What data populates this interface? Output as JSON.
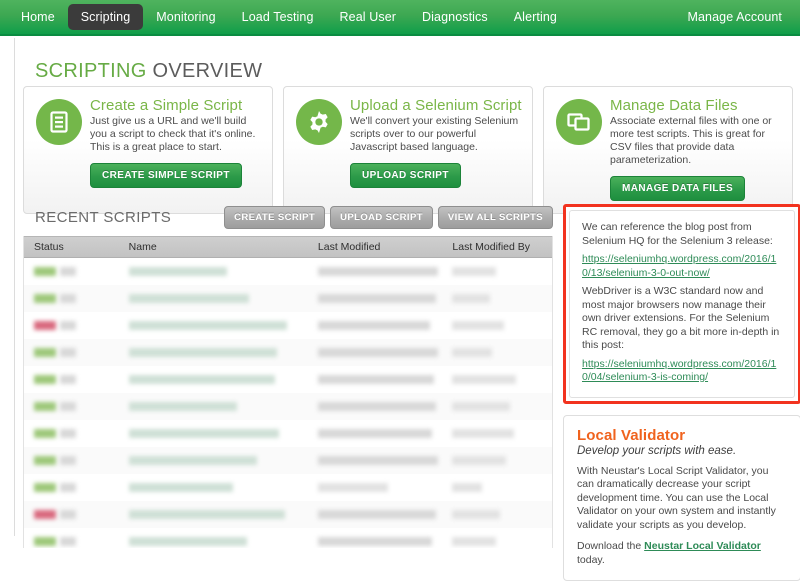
{
  "nav": {
    "items": [
      {
        "label": "Home",
        "active": false
      },
      {
        "label": "Scripting",
        "active": true
      },
      {
        "label": "Monitoring",
        "active": false
      },
      {
        "label": "Load Testing",
        "active": false
      },
      {
        "label": "Real User",
        "active": false
      },
      {
        "label": "Diagnostics",
        "active": false
      },
      {
        "label": "Alerting",
        "active": false
      }
    ],
    "account_label": "Manage Account"
  },
  "page": {
    "title_highlight": "SCRIPTING",
    "title_rest": " OVERVIEW"
  },
  "cards": [
    {
      "icon": "document-lines-icon",
      "title": "Create a Simple Script",
      "desc": "Just give us a URL and we'll build you a script to check that it's online. This is a great place to start.",
      "button": "CREATE SIMPLE SCRIPT"
    },
    {
      "icon": "gear-icon",
      "title": "Upload a Selenium Script",
      "desc": "We'll convert your existing Selenium scripts over to our powerful Javascript based language.",
      "button": "UPLOAD SCRIPT"
    },
    {
      "icon": "files-stack-icon",
      "title": "Manage Data Files",
      "desc": "Associate external files with one or more test scripts. This is great for CSV files that provide data parameterization.",
      "button": "MANAGE DATA FILES"
    }
  ],
  "recent": {
    "heading": "RECENT SCRIPTS",
    "buttons": [
      "CREATE SCRIPT",
      "UPLOAD SCRIPT",
      "VIEW ALL SCRIPTS"
    ],
    "columns": [
      "Status",
      "Name",
      "Last Modified",
      "Last Modified By"
    ],
    "rows_redacted": 11
  },
  "note": {
    "paragraph1": "We can reference the blog post from Selenium HQ for the Selenium 3 release:",
    "link1": "https://seleniumhq.wordpress.com/2016/10/13/selenium-3-0-out-now/",
    "paragraph2": "WebDriver is a W3C standard now and most major browsers now manage their own driver extensions. For the Selenium RC removal, they go a bit more in-depth in this post:",
    "link2": "https://seleniumhq.wordpress.com/2016/10/04/selenium-3-is-coming/",
    "highlight_color": "#f2331f"
  },
  "local_validator": {
    "title": "Local Validator",
    "subtitle": "Develop your scripts with ease.",
    "body": "With Neustar's Local Script Validator, you can dramatically decrease your script development time. You can use the Local Validator on your own system and instantly validate your scripts as you develop.",
    "download_prefix": "Download the ",
    "download_link": "Neustar Local Validator",
    "download_suffix": " today."
  },
  "colors": {
    "brand_green": "#3da852",
    "accent_green": "#74b74a",
    "orange": "#f0631e",
    "link_green": "#2e8b57"
  }
}
